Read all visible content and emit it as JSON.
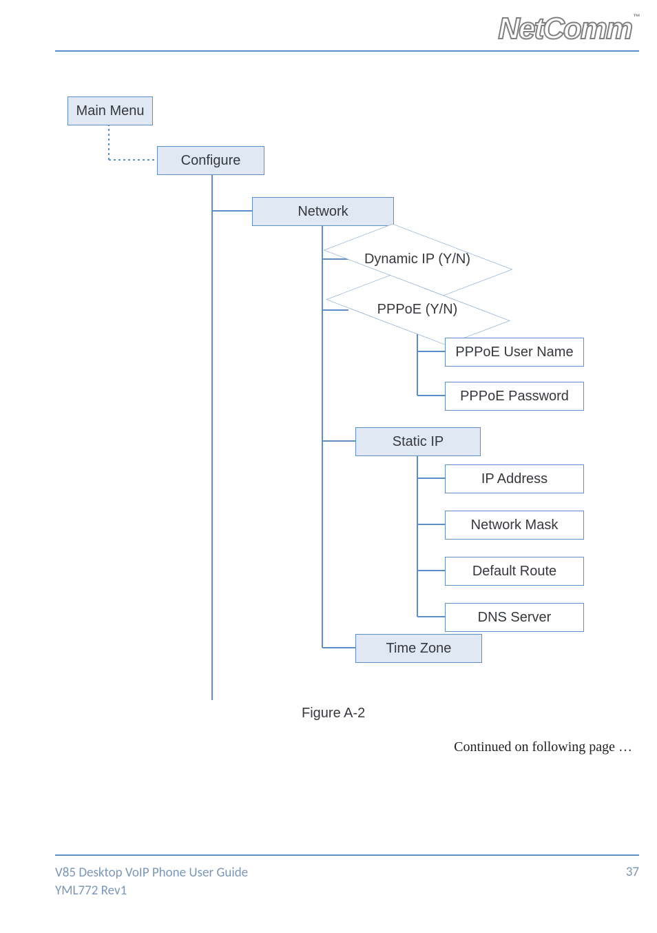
{
  "header": {
    "logo_text": "NetComm",
    "logo_tm": "™"
  },
  "diagram": {
    "main_menu": "Main Menu",
    "configure": "Configure",
    "network": "Network",
    "dynamic_ip": "Dynamic IP (Y/N)",
    "pppoe": "PPPoE (Y/N)",
    "pppoe_user": "PPPoE User Name",
    "pppoe_pass": "PPPoE Password",
    "static_ip": "Static IP",
    "ip_addr": "IP Address",
    "net_mask": "Network Mask",
    "def_route": "Default Route",
    "dns": "DNS Server",
    "time_zone": "Time Zone",
    "caption": "Figure A-2"
  },
  "continued": "Continued on following page …",
  "footer": {
    "line1": "V85 Desktop VoIP Phone User Guide",
    "line2": "YML772 Rev1",
    "page": "37"
  },
  "chart_data": {
    "type": "tree",
    "root": {
      "label": "Main Menu",
      "children": [
        {
          "label": "Configure",
          "children": [
            {
              "label": "Network",
              "children": [
                {
                  "label": "Dynamic IP (Y/N)",
                  "kind": "decision"
                },
                {
                  "label": "PPPoE (Y/N)",
                  "kind": "decision",
                  "children": [
                    {
                      "label": "PPPoE User Name"
                    },
                    {
                      "label": "PPPoE Password"
                    }
                  ]
                },
                {
                  "label": "Static IP",
                  "children": [
                    {
                      "label": "IP Address"
                    },
                    {
                      "label": "Network Mask"
                    },
                    {
                      "label": "Default Route"
                    },
                    {
                      "label": "DNS Server"
                    }
                  ]
                },
                {
                  "label": "Time Zone"
                }
              ]
            }
          ]
        }
      ]
    }
  }
}
